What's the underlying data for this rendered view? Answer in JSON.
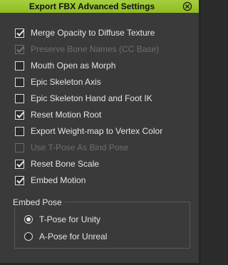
{
  "dialog": {
    "title": "Export FBX Advanced Settings",
    "close_icon": "close-circle-icon"
  },
  "options": [
    {
      "label": "Merge Opacity to Diffuse Texture",
      "checked": true,
      "enabled": true
    },
    {
      "label": "Preserve Bone Names (CC Base)",
      "checked": true,
      "enabled": false
    },
    {
      "label": "Mouth Open as Morph",
      "checked": false,
      "enabled": true
    },
    {
      "label": "Epic Skeleton Axis",
      "checked": false,
      "enabled": true
    },
    {
      "label": "Epic Skeleton Hand and Foot IK",
      "checked": false,
      "enabled": true
    },
    {
      "label": "Reset Motion Root",
      "checked": true,
      "enabled": true
    },
    {
      "label": "Export Weight-map to Vertex Color",
      "checked": false,
      "enabled": true
    },
    {
      "label": "Use T-Pose As Bind Pose",
      "checked": false,
      "enabled": false
    },
    {
      "label": "Reset Bone Scale",
      "checked": true,
      "enabled": true
    },
    {
      "label": "Embed Motion",
      "checked": true,
      "enabled": true
    }
  ],
  "embed_pose": {
    "title": "Embed Pose",
    "choices": [
      {
        "label": "T-Pose for Unity",
        "selected": true
      },
      {
        "label": "A-Pose for Unreal",
        "selected": false
      }
    ]
  },
  "colors": {
    "title_bar": "#9ac52d",
    "background": "#3a3a3a",
    "text": "#e4e4e4",
    "disabled_text": "#6e6e6e"
  }
}
